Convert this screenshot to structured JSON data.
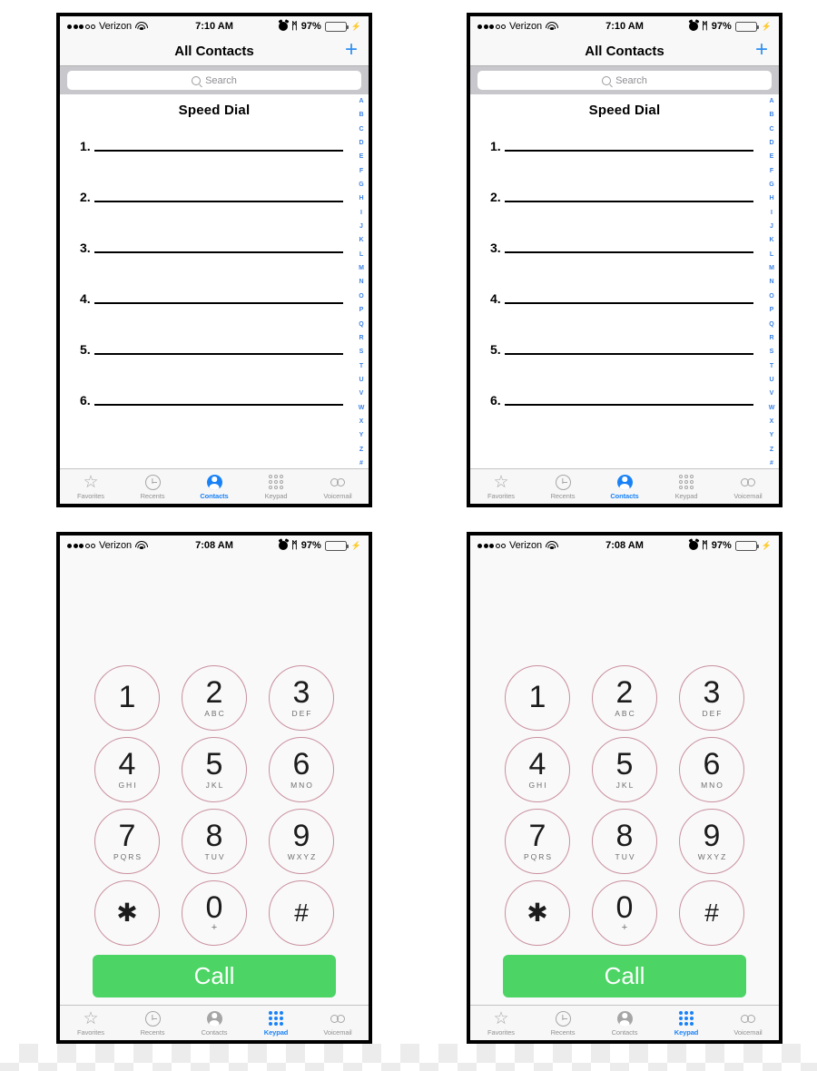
{
  "status_bar": {
    "signal_dots_filled": 3,
    "signal_dots_empty": 2,
    "carrier": "Verizon",
    "wifi_icon": "wifi-icon",
    "time_contacts": "7:10 AM",
    "time_keypad": "7:08 AM",
    "alarm_icon": "alarm-clock-icon",
    "bluetooth_icon": "bluetooth-icon",
    "bluetooth_glyph": "ᛗ",
    "battery_percent": "97%",
    "battery_level": 97,
    "battery_color": "#4cd964",
    "charging_glyph": "⚡"
  },
  "contacts_screen": {
    "nav": {
      "title": "All Contacts",
      "add_button": "+",
      "add_button_color": "#2f8ef0"
    },
    "search": {
      "placeholder": "Search",
      "icon": "search-icon"
    },
    "speed_dial": {
      "title": "Speed Dial",
      "entries": [
        {
          "number": "1.",
          "value": ""
        },
        {
          "number": "2.",
          "value": ""
        },
        {
          "number": "3.",
          "value": ""
        },
        {
          "number": "4.",
          "value": ""
        },
        {
          "number": "5.",
          "value": ""
        },
        {
          "number": "6.",
          "value": ""
        }
      ]
    },
    "alphabet_index": {
      "color": "#3b82e8",
      "letters": [
        "A",
        "B",
        "C",
        "D",
        "E",
        "F",
        "G",
        "H",
        "I",
        "J",
        "K",
        "L",
        "M",
        "N",
        "O",
        "P",
        "Q",
        "R",
        "S",
        "T",
        "U",
        "V",
        "W",
        "X",
        "Y",
        "Z",
        "#"
      ]
    },
    "tabs": [
      {
        "label": "Favorites",
        "icon": "star-icon",
        "active": false
      },
      {
        "label": "Recents",
        "icon": "clock-icon",
        "active": false
      },
      {
        "label": "Contacts",
        "icon": "person-icon",
        "active": true
      },
      {
        "label": "Keypad",
        "icon": "keypad-dots-icon",
        "active": false
      },
      {
        "label": "Voicemail",
        "icon": "voicemail-icon",
        "active": false
      }
    ]
  },
  "keypad_screen": {
    "keys": [
      {
        "digit": "1",
        "sub": ""
      },
      {
        "digit": "2",
        "sub": "ABC"
      },
      {
        "digit": "3",
        "sub": "DEF"
      },
      {
        "digit": "4",
        "sub": "GHI"
      },
      {
        "digit": "5",
        "sub": "JKL"
      },
      {
        "digit": "6",
        "sub": "MNO"
      },
      {
        "digit": "7",
        "sub": "PQRS"
      },
      {
        "digit": "8",
        "sub": "TUV"
      },
      {
        "digit": "9",
        "sub": "WXYZ"
      },
      {
        "digit": "✱",
        "sub": ""
      },
      {
        "digit": "0",
        "sub": "+"
      },
      {
        "digit": "#",
        "sub": ""
      }
    ],
    "call_button": {
      "label": "Call",
      "color": "#4cd465"
    },
    "key_border_color": "#c9909f",
    "tabs": [
      {
        "label": "Favorites",
        "icon": "star-icon",
        "active": false
      },
      {
        "label": "Recents",
        "icon": "clock-icon",
        "active": false
      },
      {
        "label": "Contacts",
        "icon": "person-icon",
        "active": false
      },
      {
        "label": "Keypad",
        "icon": "keypad-dots-icon",
        "active": true
      },
      {
        "label": "Voicemail",
        "icon": "voicemail-icon",
        "active": false
      }
    ]
  }
}
